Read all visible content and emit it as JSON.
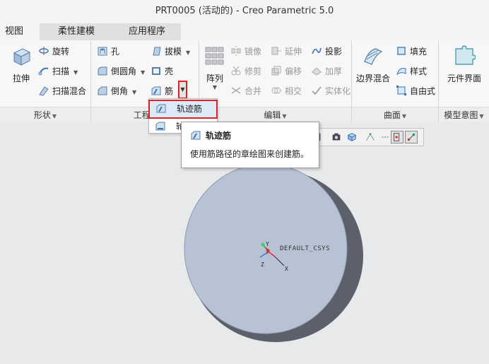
{
  "window": {
    "title": "PRT0005 (活动的) - Creo Parametric 5.0"
  },
  "tabs": [
    {
      "label": "视图"
    },
    {
      "label": "柔性建模"
    },
    {
      "label": "应用程序"
    }
  ],
  "ribbon": {
    "shape": {
      "label": "形状",
      "extrude": "拉伸",
      "revolve": "旋转",
      "sweep": "扫描",
      "swept_blend": "扫描混合"
    },
    "engineering": {
      "label": "工程",
      "hole": "孔",
      "round": "倒圆角",
      "chamfer": "倒角",
      "draft": "拔模",
      "shell": "壳",
      "rib": "筋"
    },
    "editing": {
      "label": "编辑",
      "pattern": "阵列",
      "mirror": "镜像",
      "trim": "修剪",
      "merge": "合并",
      "extend": "延伸",
      "offset": "偏移",
      "intersect": "相交",
      "project": "投影",
      "thicken": "加厚",
      "solidify": "实体化"
    },
    "surfaces": {
      "label": "曲面",
      "boundary_blend": "边界混合",
      "fill": "填充",
      "style": "样式",
      "freestyle": "自由式"
    },
    "model_intent": {
      "label": "模型意图",
      "component_interface": "元件界面"
    }
  },
  "rib_menu": {
    "items": [
      {
        "label": "轨迹筋"
      },
      {
        "label": "轮"
      }
    ]
  },
  "tooltip": {
    "title": "轨迹筋",
    "description": "使用筋路径的章绘图来创建筋。"
  },
  "viewport": {
    "csys_label": "DEFAULT_CSYS",
    "axes": {
      "x": "X",
      "y": "Y",
      "z": "Z"
    }
  },
  "colors": {
    "highlight_border": "#e02020",
    "model_face": "#b7c3d4",
    "model_side": "#5b606a",
    "menu_highlight": "#dce9f7"
  }
}
